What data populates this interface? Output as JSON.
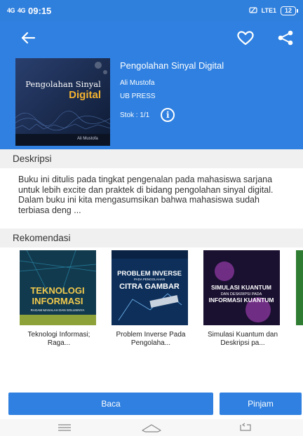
{
  "status_bar": {
    "signal_left": "4G",
    "signal_right": "4G",
    "time": "09:15",
    "network": "LTE1",
    "battery": "12"
  },
  "book": {
    "title": "Pengolahan Sinyal Digital",
    "author": "Ali Mustofa",
    "publisher": "UB PRESS",
    "stock": "Stok : 1/1",
    "cover_title": "Pengolahan Sinyal",
    "cover_subtitle": "Digital",
    "cover_author": "Ali Mustofa"
  },
  "description": {
    "heading": "Deskripsi",
    "text": "Buku ini ditulis pada tingkat pengenalan pada mahasiswa sarjana untuk lebih excite dan praktek di bidang pengolahan sinyal digital. Dalam buku ini kita mengasumsikan bahwa mahasiswa sudah terbiasa deng ..."
  },
  "recommendations": {
    "heading": "Rekomendasi",
    "items": [
      {
        "label": "Teknologi Informasi; Raga...",
        "cover_line1": "TEKNOLOGI",
        "cover_line2": "INFORMASI",
        "cover_line3": "RAGAM MASALAH DAN SOLUSINYA"
      },
      {
        "label": "Problem Inverse Pada Pengolaha...",
        "cover_line1": "PROBLEM INVERSE",
        "cover_line2": "PADA PENGOLAHAN",
        "cover_line3": "CITRA GAMBAR"
      },
      {
        "label": "Simulasi Kuantum dan Deskripsi pa...",
        "cover_line1": "SIMULASI KUANTUM",
        "cover_line2": "DAN DESKRIPSI PADA",
        "cover_line3": "INFORMASI KUANTUM"
      }
    ]
  },
  "actions": {
    "read": "Baca",
    "borrow": "Pinjam"
  },
  "colors": {
    "primary": "#2f80e0",
    "accent_gold": "#f5b330"
  },
  "icons": [
    "back-arrow-icon",
    "heart-icon",
    "share-icon",
    "info-icon",
    "menu-icon",
    "home-icon",
    "back-nav-icon"
  ]
}
